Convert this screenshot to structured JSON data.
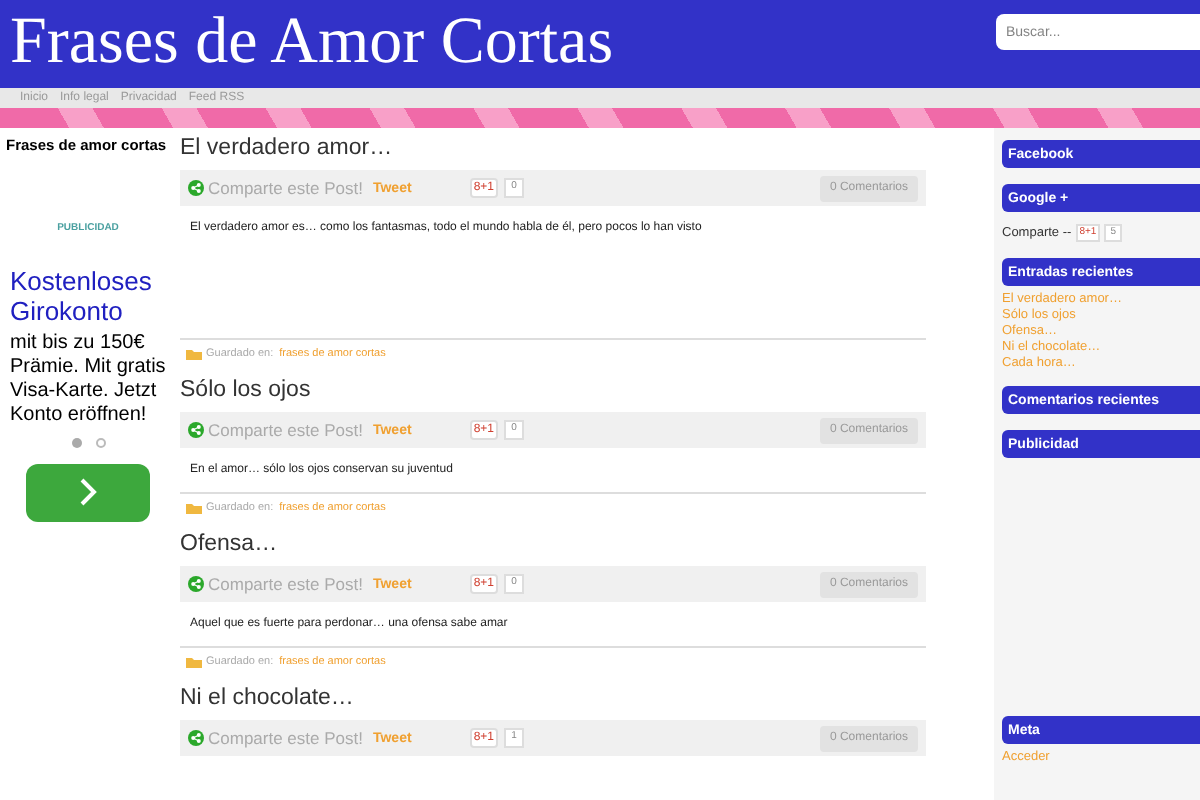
{
  "header": {
    "title": "Frases de Amor Cortas",
    "search": {
      "placeholder": "Buscar..."
    }
  },
  "nav": [
    "Inicio",
    "Info legal",
    "Privacidad",
    "Feed RSS"
  ],
  "left_column": {
    "heading": "Frases de amor cortas",
    "ad": {
      "label": "PUBLICIDAD",
      "headline": "Kostenloses Girokonto",
      "text": "mit bis zu 150€ Prämie. Mit gratis Visa-Karte. Jetzt Konto eröffnen!",
      "dots": [
        {
          "selected": true
        },
        {
          "selected": false
        }
      ]
    }
  },
  "posts": [
    {
      "title": "El verdadero amor…",
      "share_label": "Comparte este Post!",
      "tweet": "Tweet",
      "plus_label": "8+1",
      "plus_count": "0",
      "comments": "0 Comentarios",
      "body": "El verdadero amor es… como los fantasmas, todo el mundo habla de él,  pero pocos lo han visto",
      "saved_label": "Guardado en:",
      "category": "frases de amor cortas",
      "tall": true
    },
    {
      "title": "Sólo los ojos",
      "share_label": "Comparte este Post!",
      "tweet": "Tweet",
      "plus_label": "8+1",
      "plus_count": "0",
      "comments": "0 Comentarios",
      "body": "En el amor… sólo los ojos conservan su juventud",
      "saved_label": "Guardado en:",
      "category": "frases de amor cortas",
      "tall": false
    },
    {
      "title": "Ofensa…",
      "share_label": "Comparte este Post!",
      "tweet": "Tweet",
      "plus_label": "8+1",
      "plus_count": "0",
      "comments": "0 Comentarios",
      "body": "Aquel que es  fuerte para perdonar… una ofensa sabe amar",
      "saved_label": "Guardado en:",
      "category": "frases de amor cortas",
      "tall": false
    },
    {
      "title": "Ni el chocolate…",
      "share_label": "Comparte este Post!",
      "tweet": "Tweet",
      "plus_label": "8+1",
      "plus_count": "1",
      "comments": "0 Comentarios"
    }
  ],
  "sidebar": [
    {
      "kind": "empty",
      "title": "Facebook"
    },
    {
      "kind": "share",
      "title": "Google +",
      "label": "Comparte --",
      "plus_label": "8+1",
      "count": "5"
    },
    {
      "kind": "links",
      "title": "Entradas recientes",
      "items": [
        "El verdadero amor…",
        "Sólo los ojos",
        "Ofensa…",
        "Ni el chocolate…",
        "Cada hora…"
      ]
    },
    {
      "kind": "empty",
      "title": "Comentarios recientes"
    },
    {
      "kind": "tall",
      "title": "Publicidad"
    },
    {
      "kind": "links",
      "title": "Meta",
      "items": [
        "Acceder"
      ]
    }
  ]
}
